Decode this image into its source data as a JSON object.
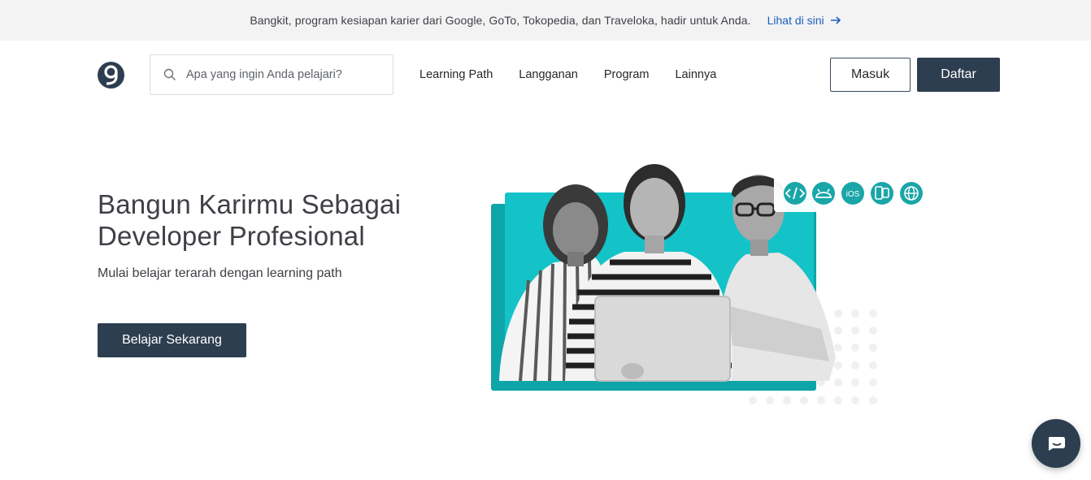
{
  "announcement": {
    "message": "Bangkit, program kesiapan karier dari Google, GoTo, Tokopedia, dan Traveloka, hadir untuk Anda.",
    "link_label": "Lihat di sini"
  },
  "search": {
    "placeholder": "Apa yang ingin Anda pelajari?"
  },
  "nav": {
    "items": [
      {
        "label": "Learning Path"
      },
      {
        "label": "Langganan"
      },
      {
        "label": "Program"
      },
      {
        "label": "Lainnya"
      }
    ]
  },
  "auth": {
    "login_label": "Masuk",
    "register_label": "Daftar"
  },
  "hero": {
    "title_line1": "Bangun Karirmu Sebagai",
    "title_line2": "Developer Profesional",
    "subtitle": "Mulai belajar terarah dengan learning path",
    "cta_label": "Belajar Sekarang",
    "tech_badges": [
      "code-icon",
      "android-icon",
      "ios-icon",
      "multiplatform-icon",
      "web-icon"
    ],
    "ios_badge_text": "iOS"
  },
  "colors": {
    "primary": "#2d3e50",
    "link": "#1d5fbf",
    "teal": "#14c3c8",
    "teal_dark": "#0ea5a8",
    "badge_icon": "#1aa6a8"
  }
}
